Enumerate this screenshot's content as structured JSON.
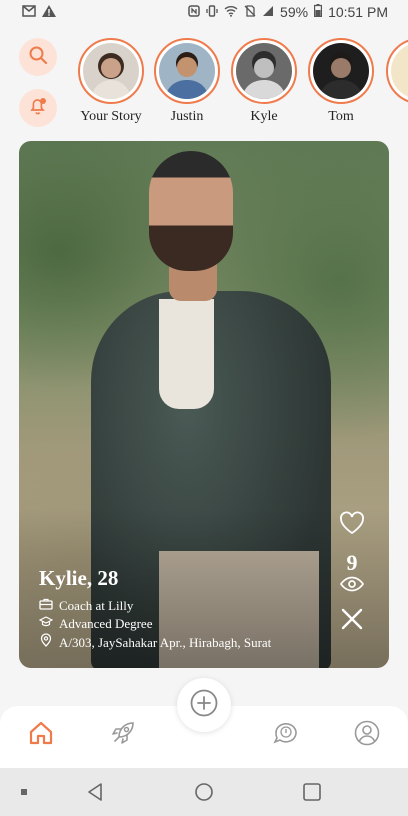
{
  "status_bar": {
    "left_icons": [
      "gmail-icon",
      "alert-icon"
    ],
    "battery": "59%",
    "time": "10:51 PM"
  },
  "stories": [
    {
      "name": "Your Story",
      "skin": "#caa289",
      "hair": "#3d2b22",
      "bg": "#d8d2ca"
    },
    {
      "name": "Justin",
      "skin": "#c3926f",
      "hair": "#2a1d16",
      "bg": "#9fb4c4"
    },
    {
      "name": "Kyle",
      "skin": "#bfbfbf",
      "hair": "#2d2d2d",
      "bg": "#6a6a6a"
    },
    {
      "name": "Tom",
      "skin": "#9a7a68",
      "hair": "#1e1a18",
      "bg": "#1e1e1e"
    }
  ],
  "profile": {
    "title": "Kylie, 28",
    "job": "Coach at Lilly",
    "education": "Advanced Degree",
    "address": "A/303, JaySahakar Apr., Hirabagh, Surat",
    "likes": "9"
  },
  "colors": {
    "accent": "#ef7b4c",
    "accent_light": "#fde3d7"
  },
  "nav_icons": [
    "home-icon",
    "rocket-icon",
    "add-icon",
    "chat-notification-icon",
    "profile-icon"
  ]
}
